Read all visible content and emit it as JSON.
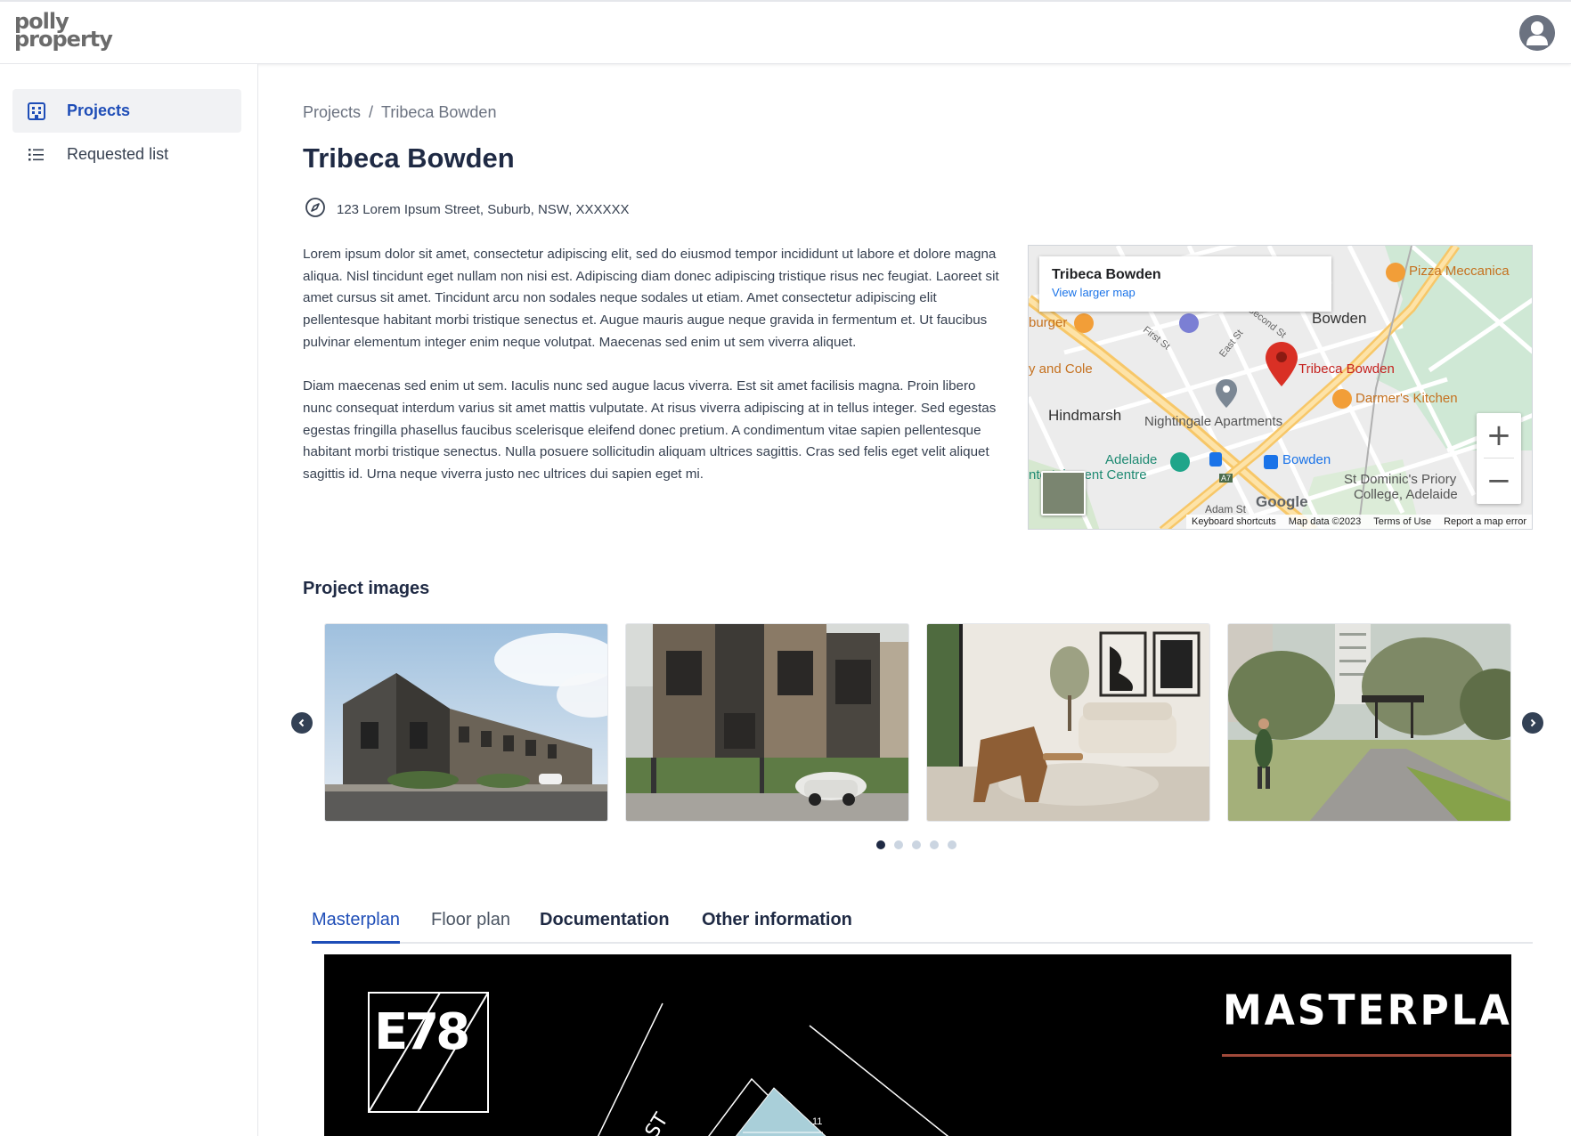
{
  "app": {
    "logo_line1": "polly",
    "logo_line2": "property"
  },
  "sidebar": {
    "items": [
      {
        "label": "Projects",
        "icon": "building-icon",
        "active": true
      },
      {
        "label": "Requested list",
        "icon": "list-icon",
        "active": false
      }
    ]
  },
  "breadcrumb": {
    "root": "Projects",
    "separator": "/",
    "current": "Tribeca Bowden"
  },
  "project": {
    "title": "Tribeca Bowden",
    "address": "123 Lorem Ipsum Street, Suburb, NSW, XXXXXX",
    "description": [
      "Lorem ipsum dolor sit amet, consectetur adipiscing elit, sed do eiusmod tempor incididunt ut labore et dolore magna aliqua. Nisl tincidunt eget nullam non nisi est. Adipiscing diam donec adipiscing tristique risus nec feugiat. Laoreet sit amet cursus sit amet. Tincidunt arcu non sodales neque sodales ut etiam. Amet consectetur adipiscing elit pellentesque habitant morbi tristique senectus et. Augue mauris augue neque gravida in fermentum et. Ut faucibus pulvinar elementum integer enim neque volutpat. Maecenas sed enim ut sem viverra aliquet.",
      "Diam maecenas sed enim ut sem. Iaculis nunc sed augue lacus viverra. Est sit amet facilisis magna. Proin libero nunc consequat interdum varius sit amet mattis vulputate. At risus viverra adipiscing at in tellus integer. Sed egestas egestas fringilla phasellus faucibus scelerisque eleifend donec pretium. A condimentum vitae sapien pellentesque habitant morbi tristique senectus. Nulla posuere sollicitudin aliquam ultrices sagittis. Cras sed felis eget velit aliquet sagittis id. Urna neque viverra justo nec ultrices dui sapien eget mi."
    ]
  },
  "map": {
    "card_title": "Tribeca Bowden",
    "card_link": "View larger map",
    "zoom_in": "+",
    "zoom_out": "−",
    "labels": {
      "pizza": "Pizza Meccanica",
      "bowden": "Bowden",
      "burger": "burger",
      "tribeca": "Tribeca Bowden",
      "and_cole": "y and Cole",
      "darmers": "Darmer's Kitchen",
      "hindmarsh": "Hindmarsh",
      "nightingale": "Nightingale Apartments",
      "adelaide": "Adelaide",
      "ent_centre": "ntertainment Centre",
      "bowden_station": "Bowden",
      "st_dominics_1": "St Dominic's Priory",
      "st_dominics_2": "College, Adelaide",
      "first_st": "First St",
      "east_st": "East St",
      "second_st": "Second St",
      "adam_st": "Adam St",
      "a7": "A7"
    },
    "wordmark": "Google",
    "footer": [
      "Keyboard shortcuts",
      "Map data ©2023",
      "Terms of Use",
      "Report a map error"
    ]
  },
  "images_section": {
    "title": "Project images",
    "images": [
      {
        "alt": "townhouses-street-view"
      },
      {
        "alt": "townhouse-facade-with-car"
      },
      {
        "alt": "living-room-interior"
      },
      {
        "alt": "park-walkway"
      }
    ],
    "dots": 5,
    "active_dot": 0
  },
  "tabs": [
    {
      "label": "Masterplan",
      "state": "active"
    },
    {
      "label": "Floor plan",
      "state": "inactive"
    },
    {
      "label": "Documentation",
      "state": "inactive"
    },
    {
      "label": "Other information",
      "state": "inactive"
    }
  ],
  "masterplan": {
    "heading": "MASTERPLAN",
    "logo_text": "E78",
    "street_text": "ST",
    "lot_number": "11"
  },
  "colors": {
    "accent": "#1e4db7",
    "title": "#1f2a44",
    "masterplan_bg": "#000000",
    "masterplan_line": "#a0493a"
  }
}
